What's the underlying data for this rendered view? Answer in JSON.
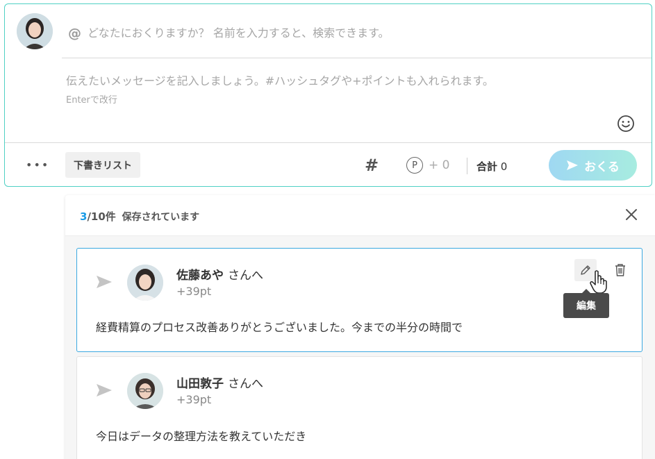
{
  "composer": {
    "to_placeholder": "どなたにおくりますか？ 名前を入力すると、検索できます。",
    "at_symbol": "@",
    "message_placeholder": "伝えたいメッセージを記入しましょう。#ハッシュタグや+ポイントも入れられます。",
    "hint": "Enterで改行",
    "footer": {
      "more_label": "•••",
      "draft_list_label": "下書きリスト",
      "hashtag_label": "#",
      "point_icon_letter": "P",
      "point_value": "+ 0",
      "total_label": "合計",
      "total_value": "0",
      "send_label": "おくる"
    }
  },
  "drafts": {
    "count_current": "3",
    "count_rest": "/10件",
    "saved_label": "保存されています",
    "tooltip": "編集",
    "items": [
      {
        "name": "佐藤あや",
        "suffix": "さんへ",
        "points": "+39pt",
        "body": "経費精算のプロセス改善ありがとうございました。今までの半分の時間で"
      },
      {
        "name": "山田敦子",
        "suffix": "さんへ",
        "points": "+39pt",
        "body": "今日はデータの整理方法を教えていただき"
      }
    ]
  },
  "colors": {
    "accent_border": "#4fd0c4",
    "selected_border": "#3aa8e0",
    "count_highlight": "#1a9be6",
    "send_gradient_start": "#9fd8f2",
    "send_gradient_end": "#a7ece0"
  }
}
